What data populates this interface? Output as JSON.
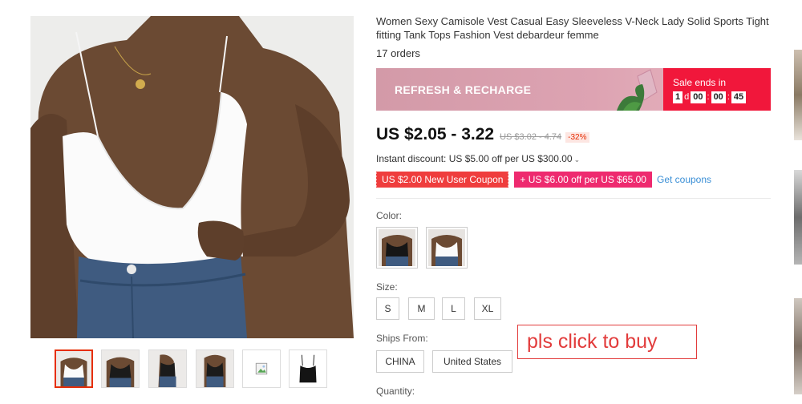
{
  "product": {
    "title": "Women Sexy Camisole Vest Casual Easy Sleeveless V-Neck Lady Solid Sports Tight fitting Tank Tops Fashion Vest debardeur femme",
    "orders": "17 orders"
  },
  "gallery": {
    "main_image": "product-photo-white-camisole",
    "thumbnails": [
      {
        "name": "white-camisole-front"
      },
      {
        "name": "black-camisole-front"
      },
      {
        "name": "black-camisole-side"
      },
      {
        "name": "black-camisole-model"
      },
      {
        "name": "broken-image-placeholder"
      },
      {
        "name": "black-camisole-flat"
      }
    ]
  },
  "banner": {
    "text": "REFRESH & RECHARGE",
    "sale_label": "Sale ends in",
    "countdown": {
      "days": "1",
      "days_unit": "d",
      "hours": "00",
      "minutes": "00",
      "seconds": "45"
    },
    "accent_color": "#f1173b"
  },
  "price": {
    "current": "US $2.05 - 3.22",
    "original": "US $3.02 - 4.74",
    "discount": "-32%"
  },
  "instant_discount": {
    "text": "Instant discount: US $5.00 off per US $300.00",
    "chevron": "⌄"
  },
  "coupons": {
    "new_user": "US $2.00 New User Coupon",
    "store": "+ US $6.00 off per US $65.00",
    "get": "Get coupons"
  },
  "color": {
    "label": "Color:",
    "options": [
      {
        "name": "black"
      },
      {
        "name": "white"
      }
    ]
  },
  "size": {
    "label": "Size:",
    "options": [
      "S",
      "M",
      "L",
      "XL"
    ]
  },
  "ships_from": {
    "label": "Ships From:",
    "options": [
      "CHINA",
      "United States"
    ]
  },
  "quantity": {
    "label": "Quantity:"
  },
  "callout": {
    "text": "pls click to buy",
    "color": "#e23c3c"
  }
}
